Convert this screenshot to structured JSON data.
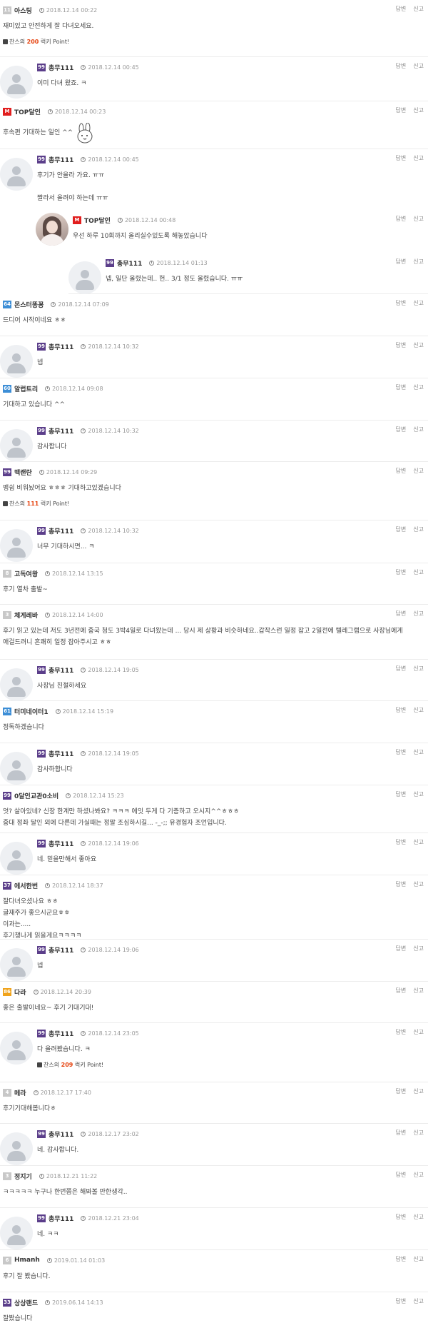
{
  "actions": {
    "reply": "답변",
    "report": "신고"
  },
  "colors": {
    "level_gray": "#c8c8c8",
    "level_red": "#e11e1e",
    "level_purple": "#5b3e8a",
    "level_blue": "#3d8ed6",
    "level_orange": "#f0a31b",
    "point": "#e6430f"
  },
  "comments": [
    {
      "level": "11",
      "level_color": "#c8c8c8",
      "nick": "아스팅",
      "date": "2018.12.14 00:22",
      "lines": [
        "재미있고 안전하게 잘 다녀오세요."
      ],
      "point": {
        "prefix": "찬스의",
        "value": "200",
        "suffix": "럭키 Point!"
      }
    },
    {
      "level": "99",
      "level_color": "#5b3e8a",
      "nick": "총무111",
      "date": "2018.12.14 00:45",
      "lines": [
        "이미 다녀 왔죠. ㅋ"
      ]
    },
    {
      "level": "M",
      "level_color": "#e11e1e",
      "nick": "TOP달인",
      "date": "2018.12.14 00:23",
      "lines": [
        "후속편 기대하는 일인 ^^"
      ],
      "emoji": "bunny-sticker"
    },
    {
      "level": "99",
      "level_color": "#5b3e8a",
      "nick": "총무111",
      "date": "2018.12.14 00:45",
      "lines": [
        "후기가 안올라 가요. ㅠㅠ",
        "",
        "짤라서 올려야 하는데 ㅠㅠ"
      ]
    },
    {
      "level": "M",
      "level_color": "#e11e1e",
      "nick": "TOP달인",
      "date": "2018.12.14 00:48",
      "lines": [
        "우선 하루 10회까지 올리실수있도록 해놓았습니다"
      ]
    },
    {
      "level": "99",
      "level_color": "#5b3e8a",
      "nick": "총무111",
      "date": "2018.12.14 01:13",
      "lines": [
        "넵, 일단 올렸는데.. 헌.. 3/1 정도 올렸습니다. ㅠㅠ"
      ]
    },
    {
      "level": "64",
      "level_color": "#3d8ed6",
      "nick": "몬스터똥꾱",
      "date": "2018.12.14 07:09",
      "lines": [
        "드디어 시작이네요 ㅎㅎ"
      ]
    },
    {
      "level": "99",
      "level_color": "#5b3e8a",
      "nick": "총무111",
      "date": "2018.12.14 10:32",
      "lines": [
        "넵"
      ]
    },
    {
      "level": "60",
      "level_color": "#3d8ed6",
      "nick": "알럽트리",
      "date": "2018.12.14 09:08",
      "lines": [
        "기대하고 있습니다 ^^"
      ]
    },
    {
      "level": "99",
      "level_color": "#5b3e8a",
      "nick": "총무111",
      "date": "2018.12.14 10:32",
      "lines": [
        "감사합니다"
      ]
    },
    {
      "level": "99",
      "level_color": "#5b3e8a",
      "nick": "맥랜란",
      "date": "2018.12.14 09:29",
      "lines": [
        "뱅쉼 비워놨어요 ㅎㅎㅎ 기대하고있겠습니다"
      ],
      "point": {
        "prefix": "찬스의",
        "value": "111",
        "suffix": "럭키 Point!"
      }
    },
    {
      "level": "99",
      "level_color": "#5b3e8a",
      "nick": "총무111",
      "date": "2018.12.14 10:32",
      "lines": [
        "너무 기대하시면... ㅋ"
      ]
    },
    {
      "level": "8",
      "level_color": "#c8c8c8",
      "nick": "고독여왕",
      "date": "2018.12.14 13:15",
      "lines": [
        "후기 열차 출발~"
      ]
    },
    {
      "level": "3",
      "level_color": "#c8c8c8",
      "nick": "체게레바",
      "date": "2018.12.14 14:00",
      "lines": [
        "후기 읽고 있는데 저도 3년전에 중국 청도 3박4일로 다녀왔는데 ... 당시 제 상황과 비슷하네요..갑작스런 일정 잡고 2일전에 텔레그램으로 사장님에게",
        "애걸드려니 흔쾌히 일정 잡아주시고 ㅎㅎ"
      ]
    },
    {
      "level": "99",
      "level_color": "#5b3e8a",
      "nick": "총무111",
      "date": "2018.12.14 19:05",
      "lines": [
        "사장님 친절하세요"
      ]
    },
    {
      "level": "61",
      "level_color": "#3d8ed6",
      "nick": "터미네이터1",
      "date": "2018.12.14 15:19",
      "lines": [
        "정독하겠습니다"
      ]
    },
    {
      "level": "99",
      "level_color": "#5b3e8a",
      "nick": "총무111",
      "date": "2018.12.14 19:05",
      "lines": [
        "감사하합니다"
      ]
    },
    {
      "level": "99",
      "level_color": "#5b3e8a",
      "nick": "0달인교관0소비",
      "date": "2018.12.14 15:23",
      "lines": [
        "엇? 살아있네? 신장 한계만 하셨나봐요? ㅋㅋㅋ 에잇 두게 다 기증하고 오시지^^ㅎㅎㅎ",
        "중대 정좌 달인 외에 다른데 가실때는 정말 조심하시길... -_-;; 유경험자 조언입니다."
      ]
    },
    {
      "level": "99",
      "level_color": "#5b3e8a",
      "nick": "총무111",
      "date": "2018.12.14 19:06",
      "lines": [
        "네. 믿을만해서 좋아요"
      ]
    },
    {
      "level": "37",
      "level_color": "#5b3e8a",
      "nick": "에서한번",
      "date": "2018.12.14 18:37",
      "lines": [
        "잘다녀오셨나요 ㅎㅎ",
        "글재주가 좋으시군요ㅎㅎ",
        "이과는.....",
        "후기챙나게 읽을게요ㅋㅋㅋㅋ"
      ]
    },
    {
      "level": "99",
      "level_color": "#5b3e8a",
      "nick": "총무111",
      "date": "2018.12.14 19:06",
      "lines": [
        "넵"
      ]
    },
    {
      "level": "86",
      "level_color": "#f0a31b",
      "nick": "다라",
      "date": "2018.12.14 20:39",
      "lines": [
        "좋은 출발이네요~ 후기 기대기대!"
      ]
    },
    {
      "level": "99",
      "level_color": "#5b3e8a",
      "nick": "총무111",
      "date": "2018.12.14 23:05",
      "lines": [
        "다 올려봤습니다. ㅋ"
      ],
      "point": {
        "prefix": "찬스의",
        "value": "209",
        "suffix": "럭키 Point!"
      }
    },
    {
      "level": "4",
      "level_color": "#c8c8c8",
      "nick": "메라",
      "date": "2018.12.17 17:40",
      "lines": [
        "후기기대해봅니다ㅎ"
      ]
    },
    {
      "level": "99",
      "level_color": "#5b3e8a",
      "nick": "총무111",
      "date": "2018.12.17 23:02",
      "lines": [
        "네. 감사합니다."
      ]
    },
    {
      "level": "3",
      "level_color": "#c8c8c8",
      "nick": "정지기",
      "date": "2018.12.21 11:22",
      "lines": [
        "ㅋㅋㅋㅋㅋ 누구나 한번쯤은 해봐볼 만한생각.."
      ]
    },
    {
      "level": "99",
      "level_color": "#5b3e8a",
      "nick": "총무111",
      "date": "2018.12.21 23:04",
      "lines": [
        "네. ㅋㅋ"
      ]
    },
    {
      "level": "6",
      "level_color": "#c8c8c8",
      "nick": "Hmanh",
      "date": "2019.01.14 01:03",
      "lines": [
        "후기 잘 봤습니다."
      ]
    },
    {
      "level": "33",
      "level_color": "#5b3e8a",
      "nick": "상상랜드",
      "date": "2019.06.14 14:13",
      "lines": [
        "잘봤습니다"
      ]
    }
  ]
}
